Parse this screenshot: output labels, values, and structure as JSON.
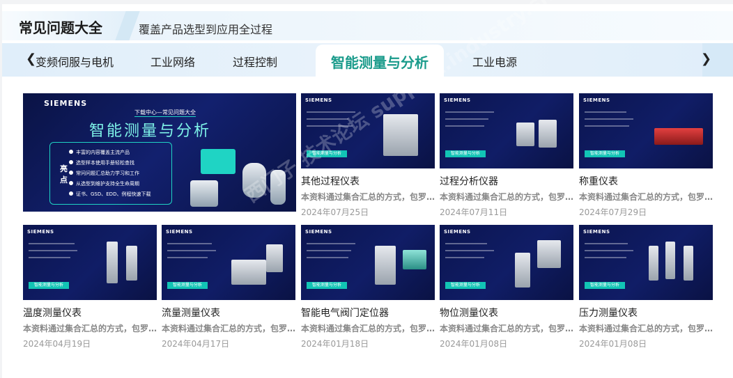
{
  "header": {
    "title": "常见问题大全",
    "subtitle": "覆盖产品选型到应用全过程"
  },
  "tabs": [
    {
      "label": "变频伺服与电机"
    },
    {
      "label": "工业网络"
    },
    {
      "label": "过程控制"
    },
    {
      "label": "智能测量与分析",
      "active": true
    },
    {
      "label": "工业电源"
    }
  ],
  "banner": {
    "brand": "SIEMENS",
    "small_title": "下载中心—常见问题大全",
    "big_title": "智能测量与分析",
    "highlight_label": "亮点",
    "points": [
      "丰富的内容覆盖主流产品",
      "选型样本使用手册轻松查找",
      "常问问题汇总助力学习和工作",
      "从选型到维护支持全生命周期",
      "证书、GSD、EDD、例程快速下载"
    ]
  },
  "cards": [
    {
      "name": "其他过程仪表",
      "desc": "本资料通过集合汇总的方式，包罗…",
      "date": "2024年07月25日",
      "brand": "SIEMENS",
      "tag": "智能测量与分析"
    },
    {
      "name": "过程分析仪器",
      "desc": "本资料通过集合汇总的方式，包罗…",
      "date": "2024年07月11日",
      "brand": "SIEMENS",
      "tag": "智能测量与分析"
    },
    {
      "name": "称重仪表",
      "desc": "本资料通过集合汇总的方式，包罗…",
      "date": "2024年07月29日",
      "brand": "SIEMENS",
      "tag": "智能测量与分析"
    },
    {
      "name": "温度测量仪表",
      "desc": "本资料通过集合汇总的方式，包罗…",
      "date": "2024年04月19日",
      "brand": "SIEMENS",
      "tag": "智能测量与分析"
    },
    {
      "name": "流量测量仪表",
      "desc": "本资料通过集合汇总的方式，包罗…",
      "date": "2024年04月17日",
      "brand": "SIEMENS",
      "tag": "智能测量与分析"
    },
    {
      "name": "智能电气阀门定位器",
      "desc": "本资料通过集合汇总的方式，包罗…",
      "date": "2024年01月18日",
      "brand": "SIEMENS",
      "tag": "智能测量与分析"
    },
    {
      "name": "物位测量仪表",
      "desc": "本资料通过集合汇总的方式，包罗…",
      "date": "2024年01月08日",
      "brand": "SIEMENS",
      "tag": "智能测量与分析"
    },
    {
      "name": "压力测量仪表",
      "desc": "本资料通过集合汇总的方式，包罗…",
      "date": "2024年01月08日",
      "brand": "SIEMENS",
      "tag": "智能测量与分析"
    }
  ],
  "watermark": "西门子 技术论坛 support.industry.siemens.com/cs",
  "icons": {
    "prev": "chevron-left-icon",
    "next": "chevron-right-icon"
  },
  "colors": {
    "accent": "#1a9b8b",
    "thumb_bg": "#101d66",
    "tag": "#12c4b5"
  }
}
